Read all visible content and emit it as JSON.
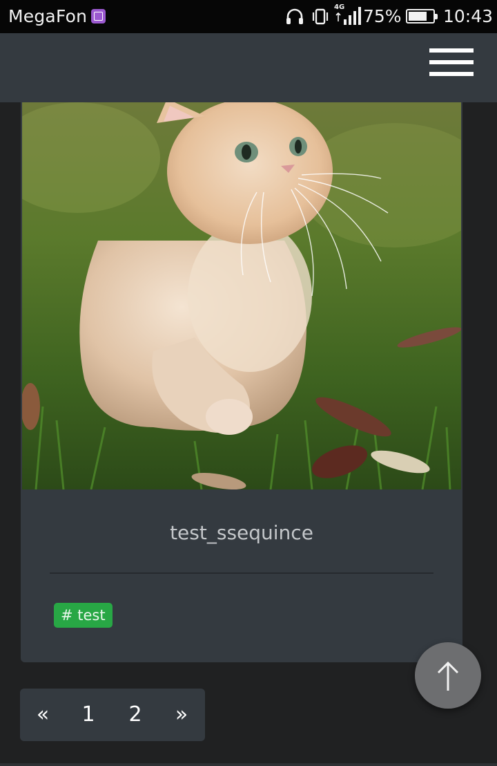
{
  "status_bar": {
    "carrier": "MegaFon",
    "network": "4G",
    "battery_percent": "75%",
    "battery_level": 0.75,
    "time": "10:43",
    "icons": [
      "gallery-notification-icon",
      "headphones-icon",
      "vibrate-icon",
      "signal-icon",
      "battery-icon"
    ]
  },
  "header": {
    "menu_icon": "hamburger-menu-icon"
  },
  "post": {
    "image_alt": "cat-photo",
    "title": "test_ssequince",
    "tags": [
      "# test"
    ]
  },
  "pagination": {
    "prev": "«",
    "pages": [
      "1",
      "2"
    ],
    "next": "»"
  },
  "scroll_top": {
    "icon": "arrow-up-icon"
  },
  "colors": {
    "background": "#202122",
    "header": "#343a40",
    "card": "#343a40",
    "tag": "#28a745",
    "scroll_button": "#6d6e70"
  }
}
